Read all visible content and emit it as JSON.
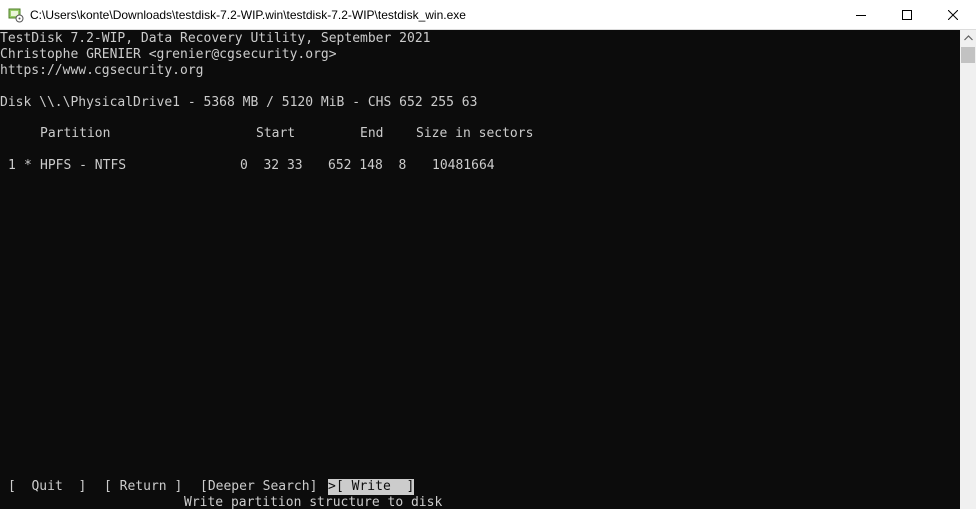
{
  "window": {
    "title": "C:\\Users\\konte\\Downloads\\testdisk-7.2-WIP.win\\testdisk-7.2-WIP\\testdisk_win.exe",
    "icon": "testdisk-app-icon",
    "controls": {
      "minimize": "minimize-icon",
      "maximize": "maximize-icon",
      "close": "close-icon"
    }
  },
  "header": {
    "line1": "TestDisk 7.2-WIP, Data Recovery Utility, September 2021",
    "line2": "Christophe GRENIER <grenier@cgsecurity.org>",
    "line3": "https://www.cgsecurity.org"
  },
  "disk": {
    "info": "Disk \\\\.\\PhysicalDrive1 - 5368 MB / 5120 MiB - CHS 652 255 63"
  },
  "table": {
    "headers": {
      "partition": "Partition",
      "start": "Start",
      "end": "End",
      "size": "Size in sectors"
    },
    "rows": [
      {
        "num": "1",
        "flag": "*",
        "type": "HPFS - NTFS",
        "start": "0  32 33",
        "end": "652 148  8",
        "size": "10481664"
      }
    ]
  },
  "menu": {
    "quit": "[  Quit  ]",
    "return": "[ Return ]",
    "deeper": "[Deeper Search]",
    "cursor": ">",
    "write": "[ Write  ]",
    "description": "Write partition structure to disk"
  },
  "colors": {
    "console_bg": "#0c0c0c",
    "console_fg": "#cccccc",
    "highlight_bg": "#cccccc"
  }
}
